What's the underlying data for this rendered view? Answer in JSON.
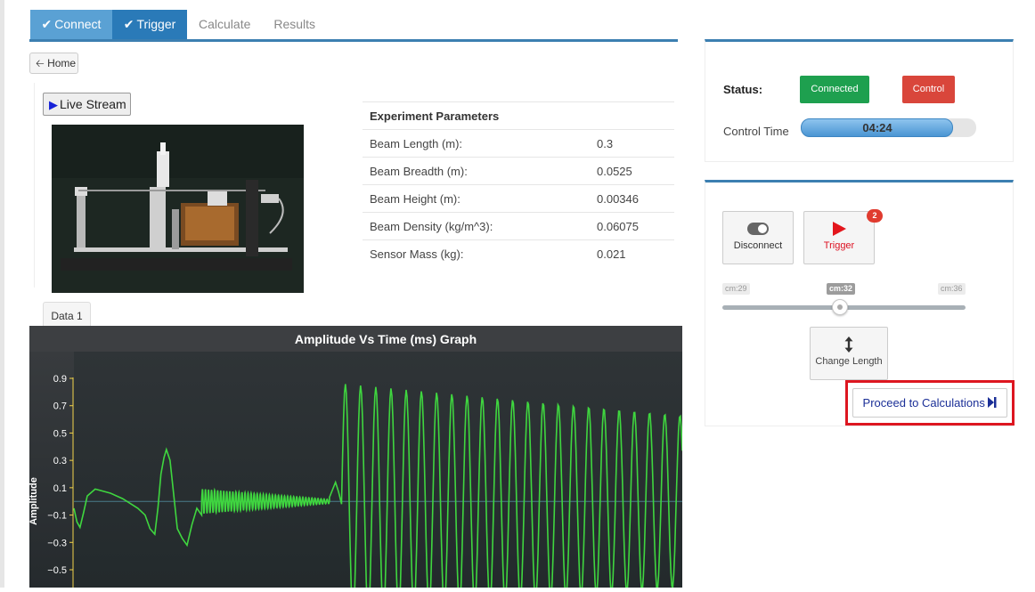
{
  "tabs": [
    {
      "label": "Connect",
      "state": "done"
    },
    {
      "label": "Trigger",
      "state": "done"
    },
    {
      "label": "Calculate",
      "state": "todo"
    },
    {
      "label": "Results",
      "state": "todo"
    }
  ],
  "check_glyph": "✔",
  "home_button": {
    "icon": "arrow-left-icon",
    "label": "Home"
  },
  "live_stream_button": {
    "icon": "play-icon",
    "label": "Live Stream"
  },
  "data_tab": {
    "label": "Data 1"
  },
  "parameters": {
    "title": "Experiment Parameters",
    "rows": [
      {
        "label": "Beam Length (m):",
        "value": "0.3"
      },
      {
        "label": "Beam Breadth (m):",
        "value": "0.0525"
      },
      {
        "label": "Beam Height (m):",
        "value": "0.00346"
      },
      {
        "label": "Beam Density (kg/m^3):",
        "value": "0.06075"
      },
      {
        "label": "Sensor Mass (kg):",
        "value": "0.021"
      }
    ]
  },
  "status": {
    "label": "Status:",
    "connected_button": "Connected",
    "control_button": "Control",
    "control_time_label": "Control Time",
    "control_time_value": "04:24",
    "control_time_fill": 0.87
  },
  "controls": {
    "disconnect_label": "Disconnect",
    "trigger_label": "Trigger",
    "trigger_badge": "2",
    "slider": {
      "min_label": "cm:29",
      "current_label": "cm:32",
      "max_label": "cm:36",
      "min": 29,
      "max": 36,
      "value": 32
    },
    "change_length_label": "Change Length",
    "proceed_label": "Proceed to Calculations",
    "proceed_icon": "step-forward-icon"
  },
  "colors": {
    "accent": "#3c7fb1",
    "connected": "#1ea04f",
    "control": "#d9463b",
    "series": "#3fd63f",
    "highlight": "#dd1620"
  },
  "chart_data": {
    "type": "line",
    "title": "Amplitude Vs Time (ms) Graph",
    "ylabel": "Amplitude",
    "xlabel": "",
    "ylim": [
      -0.6,
      0.95
    ],
    "yticks": [
      "0.9",
      "0.7",
      "0.5",
      "0.3",
      "0.1",
      "−0.1",
      "−0.3",
      "−0.5"
    ],
    "grid": false,
    "series": [
      {
        "segments": [
          {
            "type": "points",
            "x": [
              0.0,
              0.5,
              1.0,
              1.6,
              2.2,
              3.5,
              6.0,
              8.0,
              10.5,
              11.7,
              12.5,
              13.3,
              13.8,
              14.3,
              14.8,
              15.2,
              15.8,
              16.4,
              17.0,
              17.8,
              18.6,
              19.4,
              20.2,
              21.0
            ],
            "y": [
              -0.05,
              -0.15,
              -0.19,
              -0.08,
              0.04,
              0.09,
              0.06,
              0.02,
              -0.05,
              -0.1,
              -0.2,
              -0.24,
              -0.05,
              0.2,
              0.32,
              0.38,
              0.3,
              0.05,
              -0.2,
              -0.27,
              -0.32,
              -0.17,
              -0.05,
              -0.1
            ]
          },
          {
            "type": "wave",
            "x_start": 21.0,
            "x_end": 42.0,
            "period": 0.5,
            "center": 0.0,
            "amp_start": 0.09,
            "amp_end": 0.015,
            "envelope": "decay"
          },
          {
            "type": "points",
            "x": [
              42.0,
              43.0,
              43.5,
              44.0
            ],
            "y": [
              0.03,
              0.14,
              0.07,
              -0.02
            ]
          },
          {
            "type": "wave",
            "x_start": 44.0,
            "x_end": 100.0,
            "period": 2.5,
            "center": 0.0,
            "amp_start": 0.86,
            "amp_end": 0.63,
            "envelope": "decay"
          }
        ]
      }
    ]
  }
}
